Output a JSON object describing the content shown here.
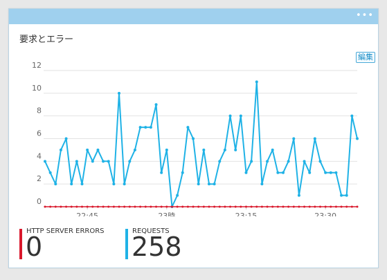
{
  "tile": {
    "title": "要求とエラー",
    "edit_label": "編集",
    "more_icon": "ellipsis-icon"
  },
  "colors": {
    "header": "#9fd0ee",
    "requests": "#1fb2e6",
    "errors": "#d9182c",
    "grid": "#e2e2e2"
  },
  "metrics": {
    "errors": {
      "label": "HTTP SERVER ERRORS",
      "value": "0"
    },
    "requests": {
      "label": "REQUESTS",
      "value": "258"
    }
  },
  "chart_data": {
    "type": "line",
    "title": "",
    "xlabel": "",
    "ylabel": "",
    "ylim": [
      0,
      12
    ],
    "yticks": [
      "0",
      "2",
      "4",
      "6",
      "8",
      "10",
      "12"
    ],
    "xtick_labels": [
      "22:45",
      "23時",
      "23:15",
      "23:30"
    ],
    "grid": true,
    "series": [
      {
        "name": "REQUESTS",
        "values": [
          4,
          3,
          2,
          5,
          6,
          2,
          4,
          2,
          5,
          4,
          5,
          4,
          4,
          2,
          10,
          2,
          4,
          5,
          7,
          7,
          7,
          9,
          3,
          5,
          0,
          1,
          3,
          7,
          6,
          2,
          5,
          2,
          2,
          4,
          5,
          8,
          5,
          8,
          3,
          4,
          11,
          2,
          4,
          5,
          3,
          3,
          4,
          6,
          1,
          4,
          3,
          6,
          4,
          3,
          3,
          3,
          1,
          1,
          8,
          6
        ]
      },
      {
        "name": "HTTP SERVER ERRORS",
        "values": [
          0,
          0,
          0,
          0,
          0,
          0,
          0,
          0,
          0,
          0,
          0,
          0,
          0,
          0,
          0,
          0,
          0,
          0,
          0,
          0,
          0,
          0,
          0,
          0,
          0,
          0,
          0,
          0,
          0,
          0,
          0,
          0,
          0,
          0,
          0,
          0,
          0,
          0,
          0,
          0,
          0,
          0,
          0,
          0,
          0,
          0,
          0,
          0,
          0,
          0,
          0,
          0,
          0,
          0,
          0,
          0,
          0,
          0,
          0,
          0
        ]
      }
    ]
  }
}
